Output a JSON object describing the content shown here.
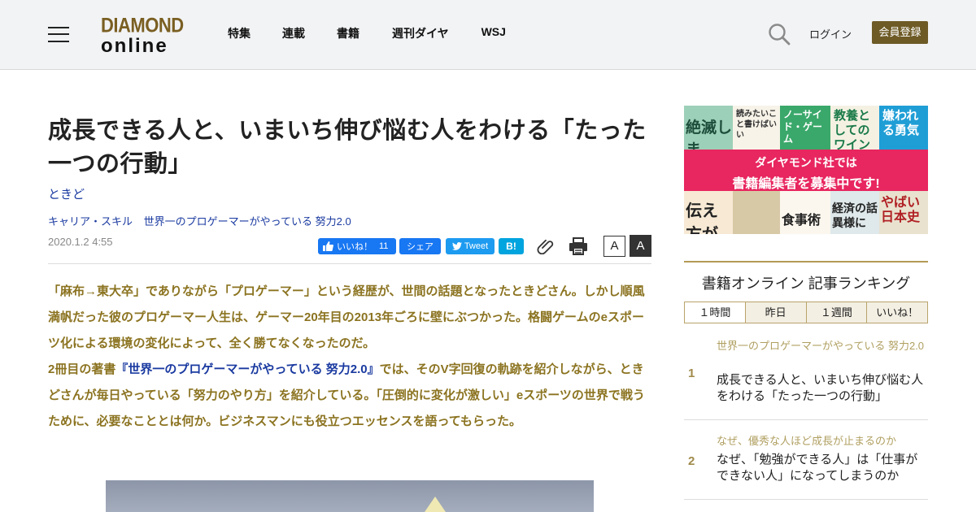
{
  "header": {
    "logo_line1": "DIAMOND",
    "logo_line2": "online",
    "nav": [
      "特集",
      "連載",
      "書籍",
      "週刊ダイヤ",
      "WSJ"
    ],
    "login_label": "ログイン",
    "register_label": "会員登録"
  },
  "article": {
    "title": "成長できる人と、いまいち伸び悩む人をわける「たった一つの行動」",
    "author": "ときど",
    "category": "キャリア・スキル",
    "series": "世界一のプロゲーマーがやっている 努力2.0",
    "date": "2020.1.2 4:55",
    "lead_part1": "「麻布→東大卒」でありながら「プロゲーマー」という経歴が、世間の話題となったときどさん。しかし順風満帆だった彼のプロゲーマー人生は、ゲーマー20年目の2013年ごろに壁にぶつかった。格闘ゲームのeスポーツ化による環境の変化によって、全く勝てなくなったのだ。",
    "lead_part2_prefix": "2冊目の著書",
    "lead_book": "『世界一のプロゲーマーがやっている 努力2.0』",
    "lead_part2_suffix": "では、そのV字回復の軌跡を紹介しながら、ときどさんが毎日やっている「努力のやり方」を紹介している。「圧倒的に変化が激しい」eスポーツの世界で戦うために、必要なこととは何か。ビジネスマンにも役立つエッセンスを語ってもらった。"
  },
  "share": {
    "like_label": "いいね！",
    "like_count": "11",
    "fb_share_label": "シェア",
    "tweet_label": "Tweet",
    "hatena_label": "B!",
    "font_small": "A",
    "font_large": "A"
  },
  "ad": {
    "banner_line1": "ダイヤモンド社では",
    "banner_line2": "書籍編集者を募集中です!",
    "tiles": [
      "絶滅しま",
      "読みたいこと書けばいい",
      "ノーサイド・ゲーム",
      "教養としてのワイン",
      "嫌われる勇気",
      "伝え方が",
      "食事術",
      "経済の話",
      "異様に",
      "やばい日本史"
    ]
  },
  "ranking": {
    "title": "書籍オンライン 記事ランキング",
    "tabs": [
      "１時間",
      "昨日",
      "１週間",
      "いいね！"
    ],
    "items": [
      {
        "rank": "1",
        "series": "世界一のプロゲーマーがやっている 努力2.0",
        "headline": "成長できる人と、いまいち伸び悩む人をわける「たった一つの行動」"
      },
      {
        "rank": "2",
        "series": "なぜ、優秀な人ほど成長が止まるのか",
        "headline": "なぜ、「勉強ができる人」は「仕事ができない人」になってしまうのか"
      }
    ]
  },
  "colors": {
    "brand_gold": "#7a5f22",
    "register_bg": "#6d5a25",
    "lead_text": "#8b7320",
    "link_blue": "#1a3aa0",
    "facebook": "#1877f2",
    "twitter": "#1d9bf0",
    "hatena": "#00a4de",
    "ad_banner": "#e8265f"
  }
}
